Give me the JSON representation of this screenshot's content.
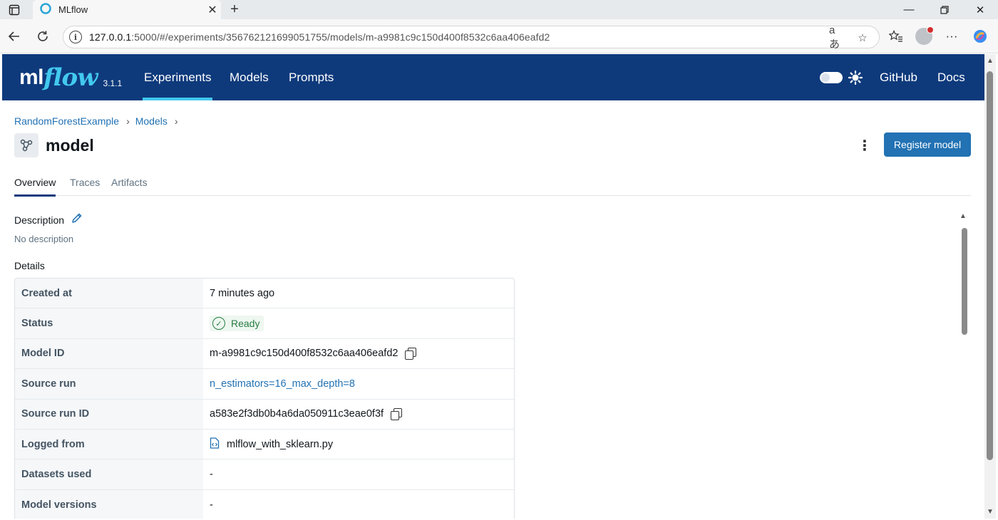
{
  "browser": {
    "tab_title": "MLflow",
    "url_host": "127.0.0.1",
    "url_rest": ":5000/#/experiments/356762121699051755/models/m-a9981c9c150d400f8532c6aa406eafd2",
    "new_tab_symbol": "+",
    "icons": [
      "sidebar-icon",
      "mlflow-favicon",
      "close-icon",
      "new-tab-icon",
      "minimize-icon",
      "restore-icon",
      "window-close-icon",
      "back-icon",
      "refresh-icon",
      "site-info-icon",
      "read-aloud-icon",
      "favorite-star-icon",
      "favorites-icon",
      "profile-avatar",
      "more-menu-icon",
      "copilot-icon"
    ]
  },
  "header": {
    "logo_ml": "ml",
    "logo_flow": "flow",
    "version": "3.1.1",
    "nav": [
      {
        "label": "Experiments",
        "active": true
      },
      {
        "label": "Models",
        "active": false
      },
      {
        "label": "Prompts",
        "active": false
      }
    ],
    "github": "GitHub",
    "docs": "Docs",
    "colors": {
      "bar": "#0e3a7c",
      "accent": "#43c9ed"
    }
  },
  "breadcrumb": [
    {
      "label": "RandomForestExample"
    },
    {
      "label": "Models"
    }
  ],
  "breadcrumb_sep": "›",
  "page": {
    "title": "model",
    "register_button": "Register model"
  },
  "tabs": [
    {
      "label": "Overview",
      "active": true
    },
    {
      "label": "Traces",
      "active": false
    },
    {
      "label": "Artifacts",
      "active": false
    }
  ],
  "description": {
    "heading": "Description",
    "text": "No description"
  },
  "details": {
    "heading": "Details",
    "rows": [
      {
        "key": "Created at",
        "value": "7 minutes ago"
      },
      {
        "key": "Status",
        "value": "Ready"
      },
      {
        "key": "Model ID",
        "value": "m-a9981c9c150d400f8532c6aa406eafd2"
      },
      {
        "key": "Source run",
        "value": "n_estimators=16_max_depth=8"
      },
      {
        "key": "Source run ID",
        "value": "a583e2f3db0b4a6da050911c3eae0f3f"
      },
      {
        "key": "Logged from",
        "value": "mlflow_with_sklearn.py"
      },
      {
        "key": "Datasets used",
        "value": "-"
      },
      {
        "key": "Model versions",
        "value": "-"
      }
    ]
  },
  "colors": {
    "primary": "#2272b4",
    "status_green": "#277c43"
  }
}
